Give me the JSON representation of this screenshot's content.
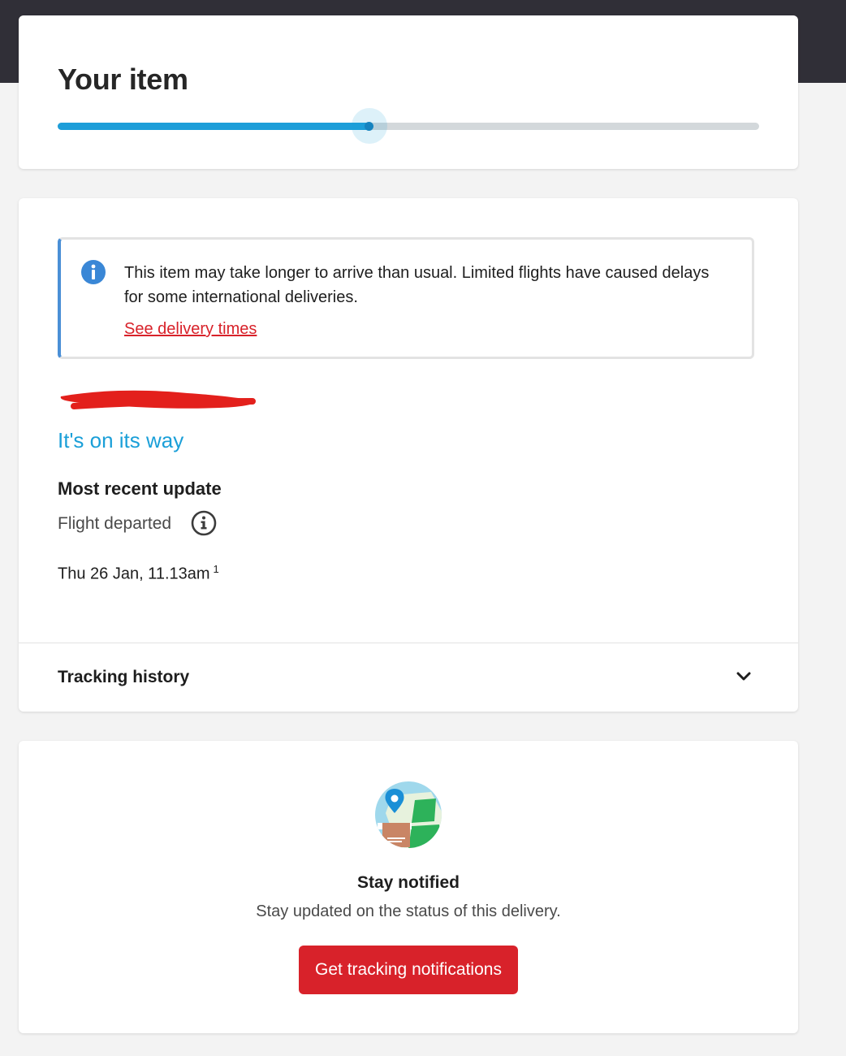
{
  "header": {
    "title": "Your item",
    "progress_fraction": 0.444
  },
  "notice": {
    "icon": "info-icon",
    "message": "This item may take longer to arrive than usual. Limited flights have caused delays for some international deliveries.",
    "link_label": "See delivery times"
  },
  "status": {
    "heading": "It's on its way",
    "recent_label": "Most recent update",
    "event": "Flight departed",
    "event_date": "Thu 26 Jan, 11.13am",
    "footnote": "1"
  },
  "history": {
    "label": "Tracking history",
    "icon": "chevron-down-icon"
  },
  "notify": {
    "title": "Stay notified",
    "subtitle": "Stay updated on the status of this delivery.",
    "button_label": "Get tracking notifications"
  },
  "colors": {
    "accent_blue": "#1d9ed9",
    "brand_red": "#d8222a",
    "header_dark": "#302f37"
  }
}
